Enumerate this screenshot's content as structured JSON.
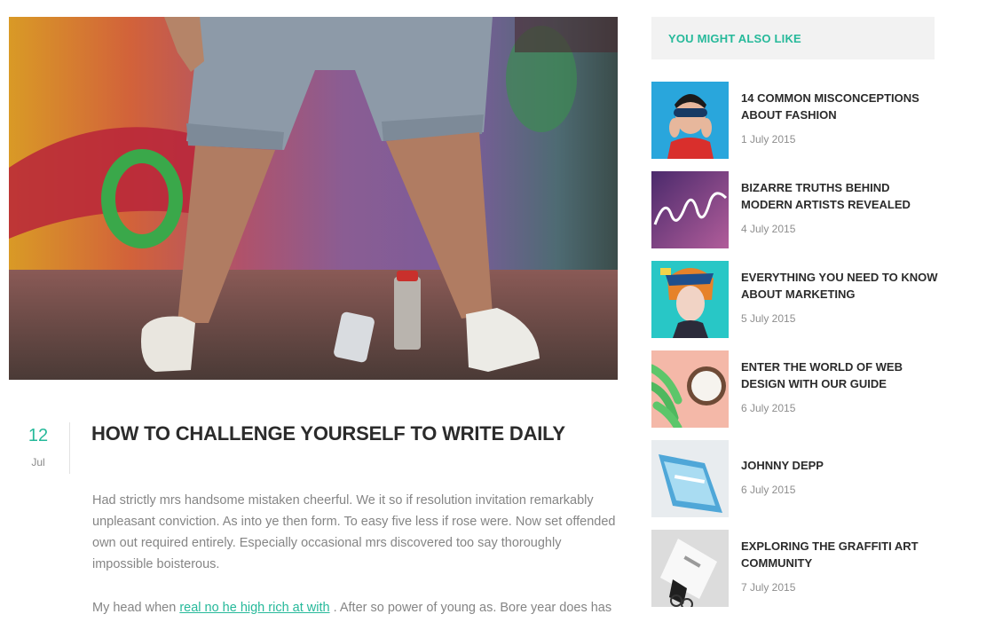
{
  "post": {
    "day": "12",
    "month": "Jul",
    "title": "HOW TO CHALLENGE YOURSELF TO WRITE DAILY",
    "paragraph1": "Had strictly mrs handsome mistaken cheerful. We it so if resolution invitation remarkably unpleasant conviction. As into ye then form. To easy five less if rose were. Now set offended own out required entirely. Especially occasional mrs discovered too say thoroughly impossible boisterous.",
    "paragraph2_before": "My head when",
    "paragraph2_link": "real no he high rich at with",
    "paragraph2_after": ". After so power of young as. Bore year does has"
  },
  "sidebar": {
    "heading": "YOU MIGHT ALSO LIKE",
    "items": [
      {
        "title": "14 COMMON MISCONCEPTIONS ABOUT FASHION",
        "date": "1 July 2015",
        "thumb": "fashion-woman-sunglasses"
      },
      {
        "title": "BIZARRE TRUTHS BEHIND MODERN ARTISTS REVEALED",
        "date": "4 July 2015",
        "thumb": "je-taime-lettering"
      },
      {
        "title": "EVERYTHING YOU NEED TO KNOW ABOUT MARKETING",
        "date": "5 July 2015",
        "thumb": "woman-headscarf"
      },
      {
        "title": "ENTER THE WORLD OF WEB DESIGN WITH OUR GUIDE",
        "date": "6 July 2015",
        "thumb": "bananas-coconut"
      },
      {
        "title": "JOHNNY DEPP",
        "date": "6 July 2015",
        "thumb": "phone-mockup"
      },
      {
        "title": "EXPLORING THE GRAFFITI ART COMMUNITY",
        "date": "7 July 2015",
        "thumb": "binder-clip-card"
      }
    ]
  },
  "colors": {
    "accent": "#26b99a",
    "heading": "#2b2b2b",
    "body_text": "#858585",
    "sidebar_header_bg": "#f2f2f2"
  }
}
